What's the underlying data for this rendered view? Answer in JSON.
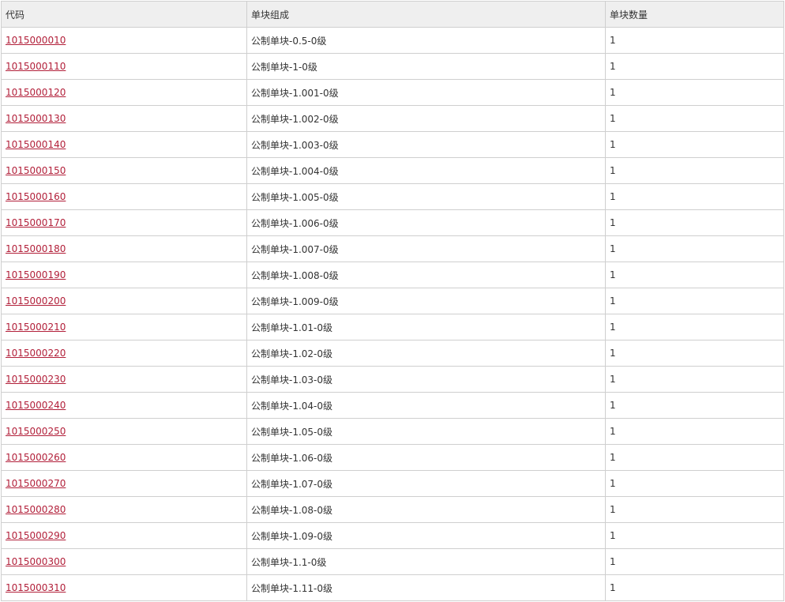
{
  "table": {
    "headers": [
      "代码",
      "单块组成",
      "单块数量"
    ],
    "rows": [
      {
        "code": "1015000010",
        "composition": "公制单块-0.5-0级",
        "count": "1"
      },
      {
        "code": "1015000110",
        "composition": "公制单块-1-0级",
        "count": "1"
      },
      {
        "code": "1015000120",
        "composition": "公制单块-1.001-0级",
        "count": "1"
      },
      {
        "code": "1015000130",
        "composition": "公制单块-1.002-0级",
        "count": "1"
      },
      {
        "code": "1015000140",
        "composition": "公制单块-1.003-0级",
        "count": "1"
      },
      {
        "code": "1015000150",
        "composition": "公制单块-1.004-0级",
        "count": "1"
      },
      {
        "code": "1015000160",
        "composition": "公制单块-1.005-0级",
        "count": "1"
      },
      {
        "code": "1015000170",
        "composition": "公制单块-1.006-0级",
        "count": "1"
      },
      {
        "code": "1015000180",
        "composition": "公制单块-1.007-0级",
        "count": "1"
      },
      {
        "code": "1015000190",
        "composition": "公制单块-1.008-0级",
        "count": "1"
      },
      {
        "code": "1015000200",
        "composition": "公制单块-1.009-0级",
        "count": "1"
      },
      {
        "code": "1015000210",
        "composition": "公制单块-1.01-0级",
        "count": "1"
      },
      {
        "code": "1015000220",
        "composition": "公制单块-1.02-0级",
        "count": "1"
      },
      {
        "code": "1015000230",
        "composition": "公制单块-1.03-0级",
        "count": "1"
      },
      {
        "code": "1015000240",
        "composition": "公制单块-1.04-0级",
        "count": "1"
      },
      {
        "code": "1015000250",
        "composition": "公制单块-1.05-0级",
        "count": "1"
      },
      {
        "code": "1015000260",
        "composition": "公制单块-1.06-0级",
        "count": "1"
      },
      {
        "code": "1015000270",
        "composition": "公制单块-1.07-0级",
        "count": "1"
      },
      {
        "code": "1015000280",
        "composition": "公制单块-1.08-0级",
        "count": "1"
      },
      {
        "code": "1015000290",
        "composition": "公制单块-1.09-0级",
        "count": "1"
      },
      {
        "code": "1015000300",
        "composition": "公制单块-1.1-0级",
        "count": "1"
      },
      {
        "code": "1015000310",
        "composition": "公制单块-1.11-0级",
        "count": "1"
      }
    ]
  },
  "colors": {
    "link": "#b2203a",
    "header_bg": "#efefef",
    "border": "#cfcfcf",
    "text": "#333333"
  }
}
